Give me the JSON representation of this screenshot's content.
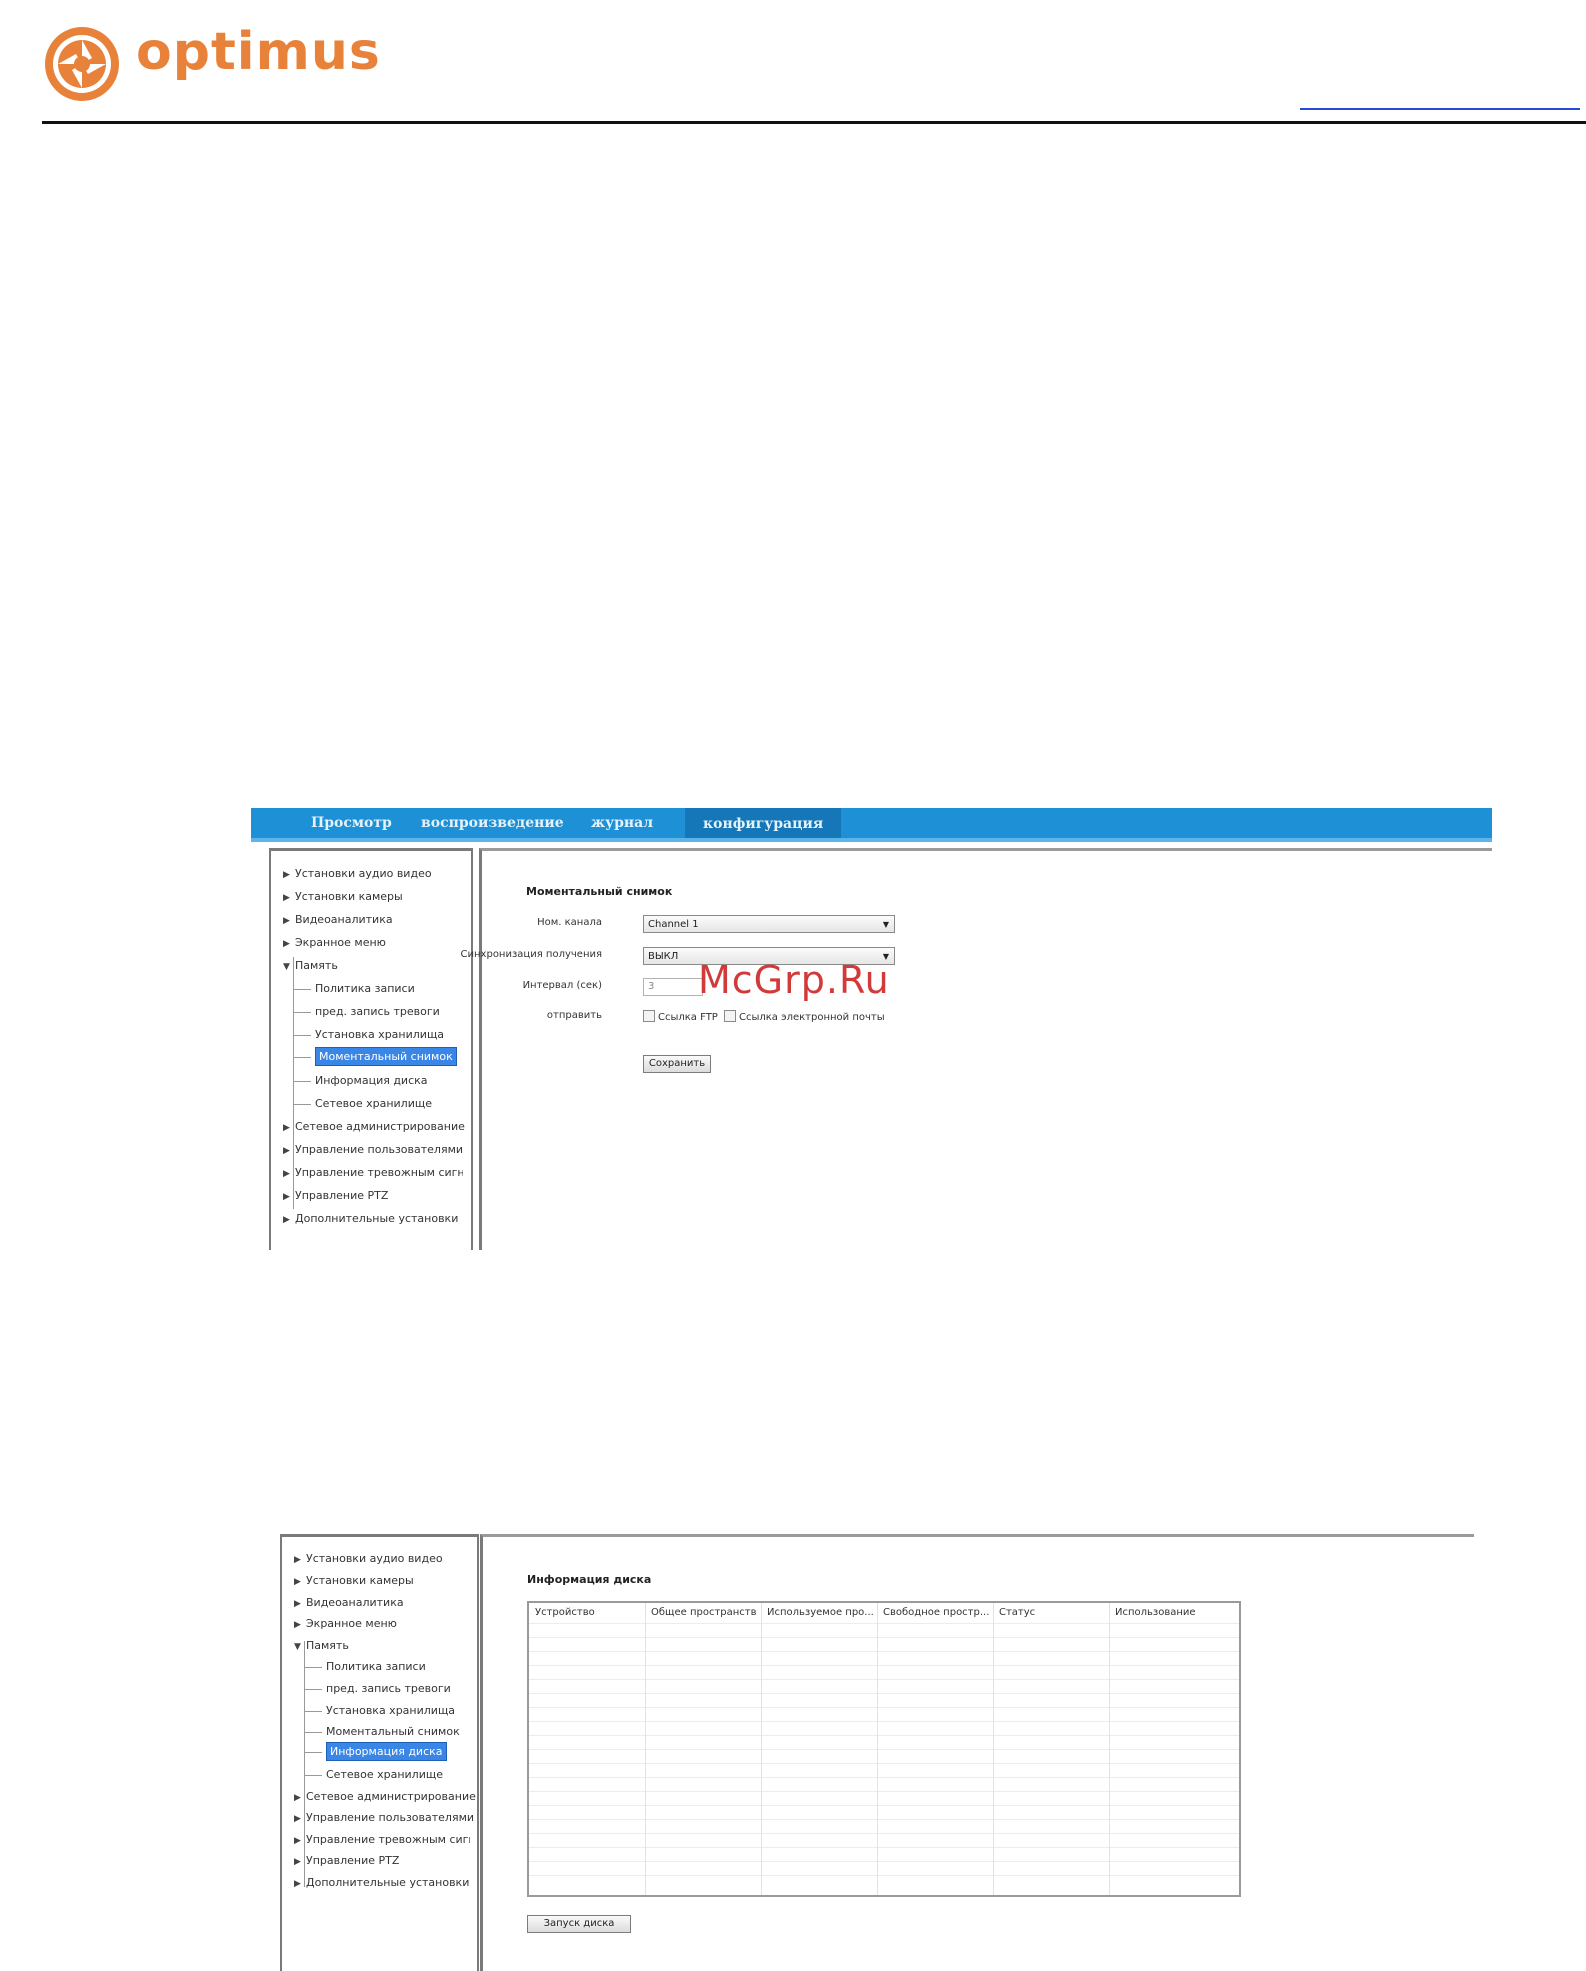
{
  "brand": {
    "name": "optimus",
    "color": "#e8823a"
  },
  "watermark": "McGrp.Ru",
  "screenshot1": {
    "tabs": [
      {
        "label": "Просмотр"
      },
      {
        "label": "воспроизведение"
      },
      {
        "label": "журнал"
      },
      {
        "label": "конфигурация",
        "active": true
      }
    ],
    "tree": [
      {
        "label": "Установки аудио видео",
        "kind": "collapsed"
      },
      {
        "label": "Установки камеры",
        "kind": "collapsed"
      },
      {
        "label": "Видеоаналитика",
        "kind": "collapsed"
      },
      {
        "label": "Экранное меню",
        "kind": "collapsed"
      },
      {
        "label": "Память",
        "kind": "expanded"
      },
      {
        "label": "Политика записи",
        "kind": "child"
      },
      {
        "label": "пред. запись тревоги",
        "kind": "child"
      },
      {
        "label": "Установка хранилища",
        "kind": "child"
      },
      {
        "label": "Моментальный снимок",
        "kind": "child",
        "selected": true
      },
      {
        "label": "Информация диска",
        "kind": "child"
      },
      {
        "label": "Сетевое хранилище",
        "kind": "child"
      },
      {
        "label": "Сетевое администрирование",
        "kind": "collapsed"
      },
      {
        "label": "Управление пользователями",
        "kind": "collapsed"
      },
      {
        "label": "Управление тревожным сигналом",
        "kind": "collapsed"
      },
      {
        "label": "Управление PTZ",
        "kind": "collapsed"
      },
      {
        "label": "Дополнительные установки",
        "kind": "collapsed"
      }
    ],
    "form": {
      "title": "Моментальный снимок",
      "channel_label": "Ном. канала",
      "channel_value": "Channel 1",
      "sync_label": "Синхронизация получения",
      "sync_value": "ВЫКЛ",
      "interval_label": "Интервал (сек)",
      "interval_value": "3",
      "send_label": "отправить",
      "ftp_label": "Ссылка FTP",
      "email_label": "Ссылка электронной почты",
      "save_label": "Сохранить"
    }
  },
  "screenshot2": {
    "tree": [
      {
        "label": "Установки аудио видео",
        "kind": "collapsed"
      },
      {
        "label": "Установки камеры",
        "kind": "collapsed"
      },
      {
        "label": "Видеоаналитика",
        "kind": "collapsed"
      },
      {
        "label": "Экранное меню",
        "kind": "collapsed"
      },
      {
        "label": "Память",
        "kind": "expanded"
      },
      {
        "label": "Политика записи",
        "kind": "child"
      },
      {
        "label": "пред. запись тревоги",
        "kind": "child"
      },
      {
        "label": "Установка хранилища",
        "kind": "child"
      },
      {
        "label": "Моментальный снимок",
        "kind": "child"
      },
      {
        "label": "Информация диска",
        "kind": "child",
        "selected": true
      },
      {
        "label": "Сетевое хранилище",
        "kind": "child"
      },
      {
        "label": "Сетевое администрирование",
        "kind": "collapsed"
      },
      {
        "label": "Управление пользователями",
        "kind": "collapsed"
      },
      {
        "label": "Управление тревожным сигналом",
        "kind": "collapsed"
      },
      {
        "label": "Управление PTZ",
        "kind": "collapsed"
      },
      {
        "label": "Дополнительные установки",
        "kind": "collapsed"
      }
    ],
    "title": "Информация диска",
    "columns": [
      "Устройство",
      "Общее пространство",
      "Используемое про...",
      "Свободное простр...",
      "Статус",
      "Использование"
    ],
    "start_button": "Запуск диска"
  }
}
